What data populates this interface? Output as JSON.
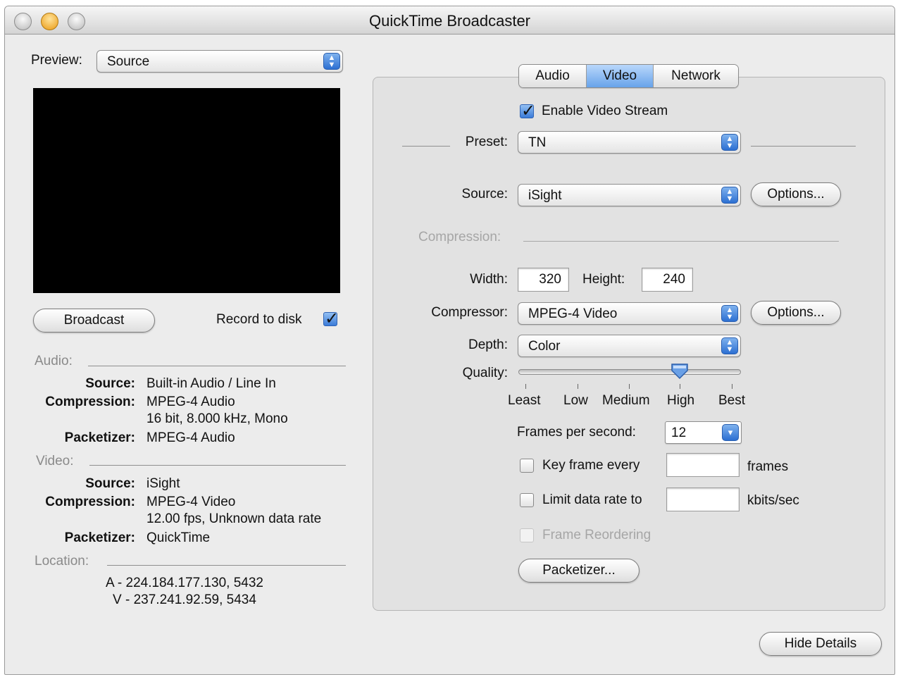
{
  "window": {
    "title": "QuickTime Broadcaster"
  },
  "left": {
    "preview_label": "Preview:",
    "preview_value": "Source",
    "broadcast_label": "Broadcast",
    "record_label": "Record to disk",
    "record_checked": true,
    "audio": {
      "header": "Audio:",
      "source_label": "Source:",
      "source_value": "Built-in Audio / Line In",
      "compression_label": "Compression:",
      "compression_value": "MPEG-4 Audio",
      "compression_detail": "16 bit, 8.000 kHz, Mono",
      "packetizer_label": "Packetizer:",
      "packetizer_value": "MPEG-4 Audio"
    },
    "video": {
      "header": "Video:",
      "source_label": "Source:",
      "source_value": "iSight",
      "compression_label": "Compression:",
      "compression_value": "MPEG-4 Video",
      "compression_detail": "12.00 fps, Unknown data rate",
      "packetizer_label": "Packetizer:",
      "packetizer_value": "QuickTime"
    },
    "location": {
      "header": "Location:",
      "audio_line": "A - 224.184.177.130, 5432",
      "video_line": "V - 237.241.92.59, 5434"
    }
  },
  "tabs": [
    {
      "label": "Audio",
      "active": false
    },
    {
      "label": "Video",
      "active": true
    },
    {
      "label": "Network",
      "active": false
    }
  ],
  "video_tab": {
    "enable_label": "Enable Video Stream",
    "enable_checked": true,
    "preset_label": "Preset:",
    "preset_value": "TN",
    "source_label": "Source:",
    "source_value": "iSight",
    "options_label": "Options...",
    "compression_header": "Compression:",
    "width_label": "Width:",
    "width_value": "320",
    "height_label": "Height:",
    "height_value": "240",
    "compressor_label": "Compressor:",
    "compressor_value": "MPEG-4 Video",
    "depth_label": "Depth:",
    "depth_value": "Color",
    "quality_label": "Quality:",
    "quality_ticks": [
      "Least",
      "Low",
      "Medium",
      "High",
      "Best"
    ],
    "quality_value": "High",
    "fps_label": "Frames per second:",
    "fps_value": "12",
    "keyframe_label": "Key frame every",
    "keyframe_unit": "frames",
    "keyframe_checked": false,
    "limit_label": "Limit data rate to",
    "limit_unit": "kbits/sec",
    "limit_checked": false,
    "reorder_label": "Frame Reordering",
    "reorder_checked": false,
    "packetizer_button": "Packetizer..."
  },
  "hide_details_label": "Hide Details"
}
